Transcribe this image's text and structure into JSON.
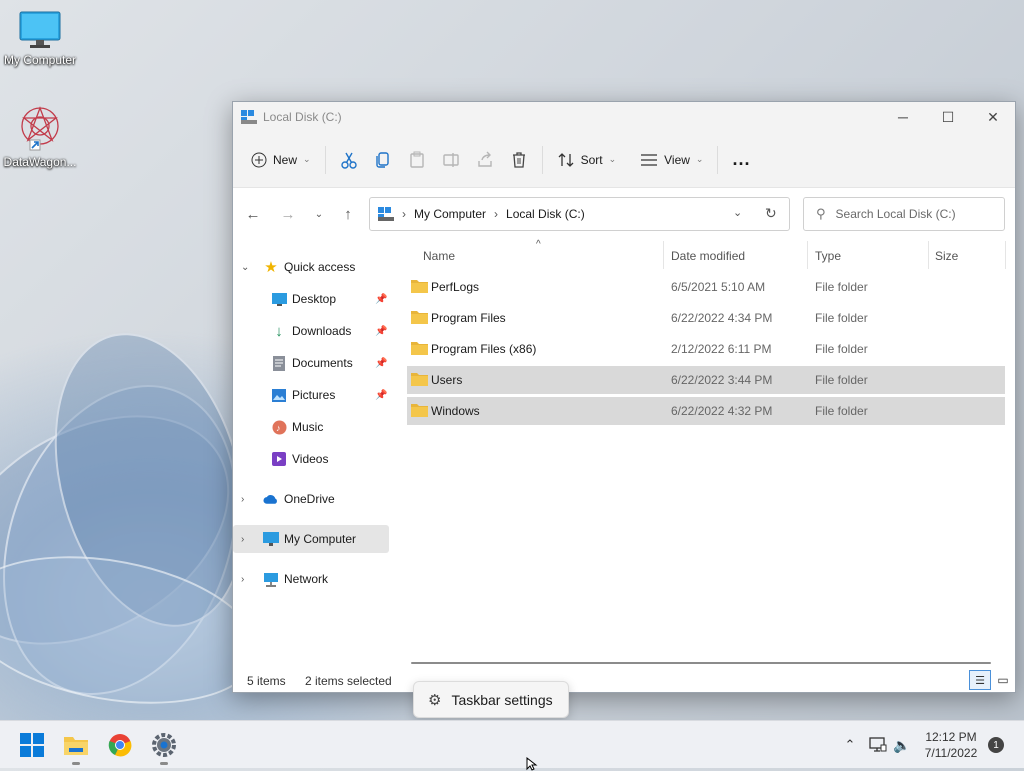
{
  "desktop": {
    "icons": [
      {
        "label": "My Computer"
      },
      {
        "label": "DataWagon..."
      }
    ]
  },
  "explorer": {
    "title": "Local Disk (C:)",
    "toolbar": {
      "new_label": "New",
      "sort_label": "Sort",
      "view_label": "View",
      "more_label": "..."
    },
    "address": {
      "crumbs": [
        "My Computer",
        "Local Disk (C:)"
      ],
      "search_placeholder": "Search Local Disk (C:)"
    },
    "sidebar": {
      "quick_access": "Quick access",
      "items": [
        "Desktop",
        "Downloads",
        "Documents",
        "Pictures",
        "Music",
        "Videos"
      ],
      "onedrive": "OneDrive",
      "my_computer": "My Computer",
      "network": "Network"
    },
    "columns": [
      "Name",
      "Date modified",
      "Type",
      "Size"
    ],
    "files": [
      {
        "name": "PerfLogs",
        "date": "6/5/2021 5:10 AM",
        "type": "File folder",
        "selected": false
      },
      {
        "name": "Program Files",
        "date": "6/22/2022 4:34 PM",
        "type": "File folder",
        "selected": false
      },
      {
        "name": "Program Files (x86)",
        "date": "2/12/2022 6:11 PM",
        "type": "File folder",
        "selected": false
      },
      {
        "name": "Users",
        "date": "6/22/2022 3:44 PM",
        "type": "File folder",
        "selected": true
      },
      {
        "name": "Windows",
        "date": "6/22/2022 4:32 PM",
        "type": "File folder",
        "selected": true
      }
    ],
    "status": {
      "items": "5 items",
      "selected": "2 items selected"
    }
  },
  "tooltip": {
    "label": "Taskbar settings"
  },
  "taskbar": {
    "time": "12:12 PM",
    "date": "7/11/2022",
    "notification_count": "1"
  },
  "colors": {
    "folder": "#f4c64a",
    "accent": "#0067c0",
    "selection": "#d9d9d9"
  }
}
